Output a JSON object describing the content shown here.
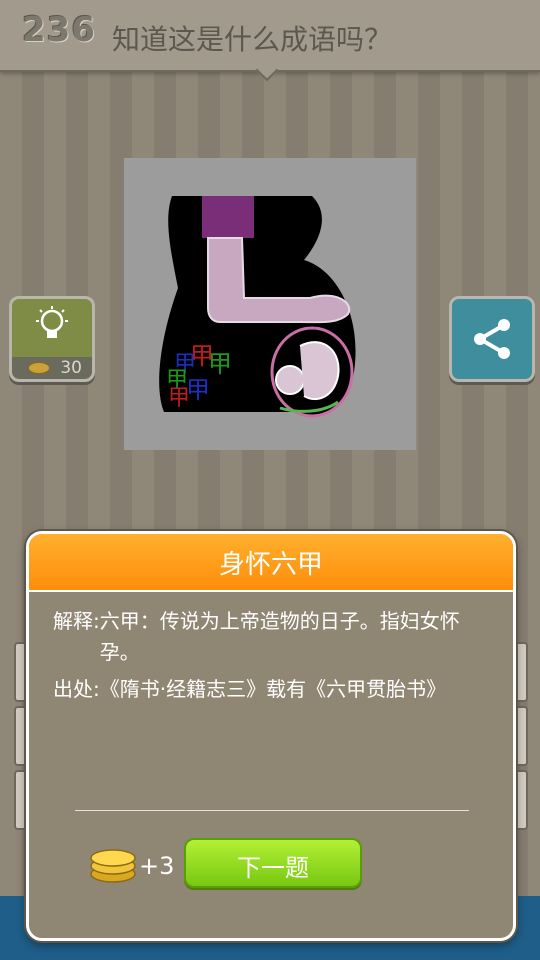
{
  "header": {
    "level": "236",
    "question": "知道这是什么成语吗？"
  },
  "hint": {
    "icon": "lightbulb-icon",
    "cost": "30"
  },
  "share": {
    "icon": "share-icon"
  },
  "picture": {
    "glyph": "甲"
  },
  "dialog": {
    "title": "身怀六甲",
    "explanation_label": "解释:",
    "explanation_text": "六甲：传说为上帝造物的日子。指妇女怀孕。",
    "source_label": "出处:",
    "source_text": "《隋书·经籍志三》载有《六甲贯胎书》",
    "reward": "+3",
    "next_label": "下一题"
  },
  "colors": {
    "accent_orange": "#ff9a16",
    "next_green": "#8fdc1c",
    "hint_green": "#7f8c45",
    "share_teal": "#3f8e9d"
  }
}
